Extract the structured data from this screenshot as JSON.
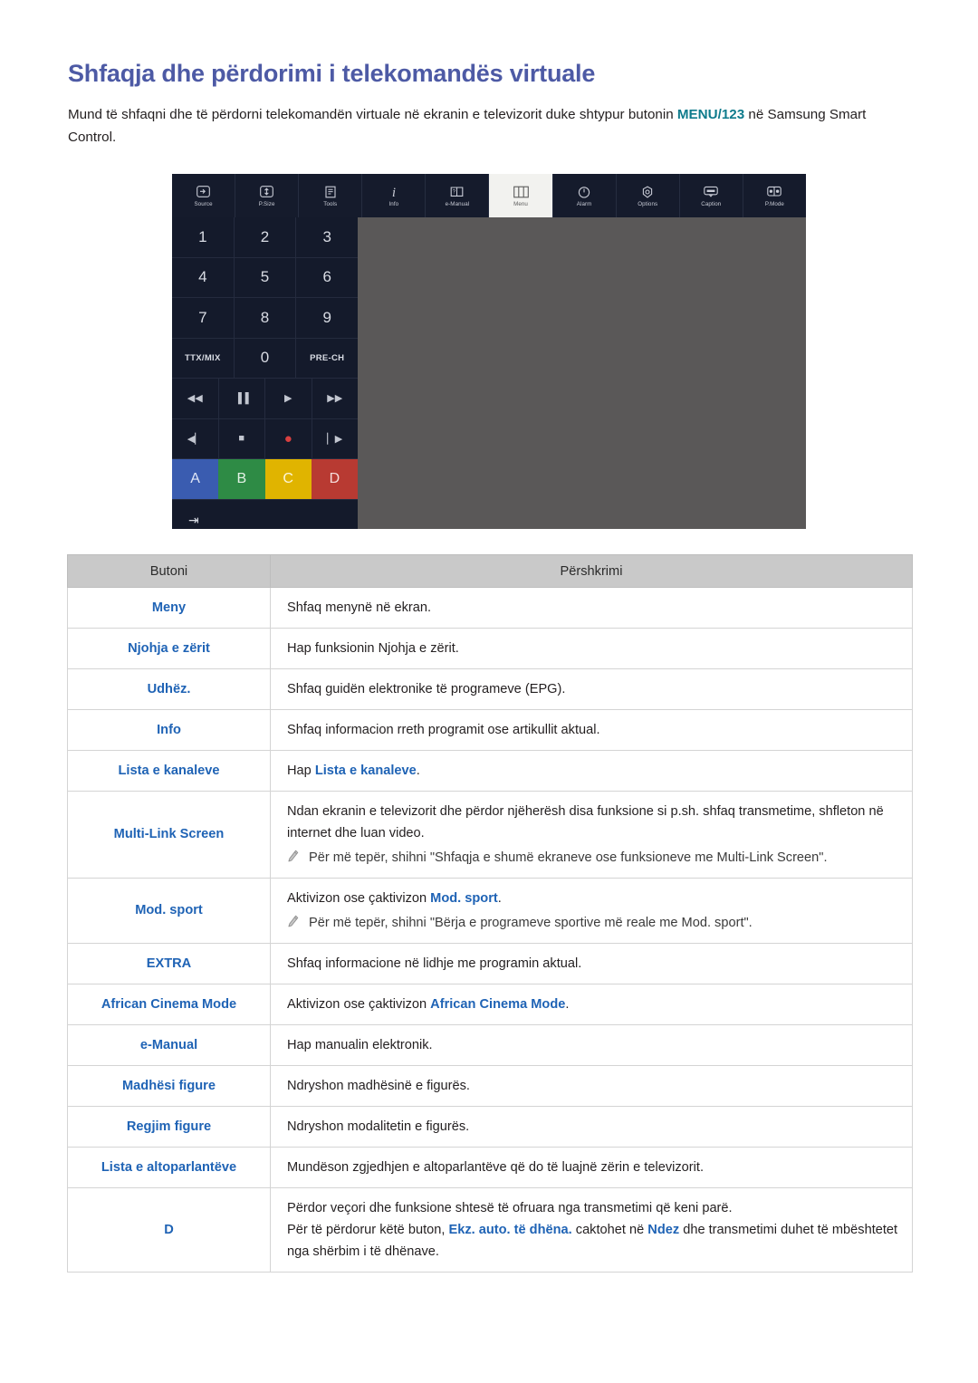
{
  "page": {
    "title": "Shfaqja dhe përdorimi i telekomandës virtuale",
    "intro_part1": "Mund të shfaqni dhe të përdorni telekomandën virtuale në ekranin e televizorit duke shtypur butonin ",
    "intro_keyword": "MENU/123",
    "intro_part2": " në Samsung Smart Control."
  },
  "colors": {
    "heading": "#4d5aa5",
    "link": "#1f63b5",
    "keyword": "#0e7b8c",
    "table_header_bg": "#c9c9c9",
    "panel_dark": "#141a2b",
    "figure_bg": "#5a5858",
    "btn_a": "#3a5cb0",
    "btn_b": "#2e8b45",
    "btn_c": "#e0b400",
    "btn_d": "#b83a32"
  },
  "remote": {
    "toolbar": [
      {
        "label": "Source",
        "icon": "source-icon",
        "selected": false
      },
      {
        "label": "P.Size",
        "icon": "picture-size-icon",
        "selected": false
      },
      {
        "label": "Tools",
        "icon": "tools-icon",
        "selected": false
      },
      {
        "label": "Info",
        "icon": "info-icon",
        "selected": false
      },
      {
        "label": "e-Manual",
        "icon": "e-manual-icon",
        "selected": false
      },
      {
        "label": "Menu",
        "icon": "menu-icon",
        "selected": true
      },
      {
        "label": "Alarm",
        "icon": "alarm-icon",
        "selected": false
      },
      {
        "label": "Options",
        "icon": "options-icon",
        "selected": false
      },
      {
        "label": "Caption",
        "icon": "caption-icon",
        "selected": false
      },
      {
        "label": "P.Mode",
        "icon": "picture-mode-icon",
        "selected": false
      }
    ],
    "keypad": [
      [
        "1",
        "2",
        "3"
      ],
      [
        "4",
        "5",
        "6"
      ],
      [
        "7",
        "8",
        "9"
      ],
      [
        "TTX/MIX",
        "0",
        "PRE-CH"
      ]
    ],
    "media_row1": [
      "rewind-icon",
      "pause-icon",
      "play-icon",
      "fast-forward-icon"
    ],
    "media_row2": [
      "previous-icon",
      "stop-icon",
      "record-icon",
      "next-icon"
    ],
    "media_row1_glyphs": [
      "◀◀",
      "▐▐",
      "▶",
      "▶▶"
    ],
    "media_row2_glyphs": [
      "◀▏",
      "■",
      "●",
      "▏▶"
    ],
    "color_buttons": [
      "A",
      "B",
      "C",
      "D"
    ],
    "bottom_button": "⇥"
  },
  "table": {
    "headers": [
      "Butoni",
      "Përshkrimi"
    ],
    "rows": [
      {
        "button": "Meny",
        "desc": "Shfaq menynë në ekran."
      },
      {
        "button": "Njohja e zërit",
        "desc": "Hap funksionin Njohja e zërit."
      },
      {
        "button": "Udhëz.",
        "desc": "Shfaq guidën elektronike të programeve (EPG)."
      },
      {
        "button": "Info",
        "desc": "Shfaq informacion rreth programit ose artikullit aktual."
      },
      {
        "button": "Lista e kanaleve",
        "desc_pre": "Hap ",
        "desc_link": "Lista e kanaleve",
        "desc_post": "."
      },
      {
        "button": "Multi-Link Screen",
        "desc": "Ndan ekranin e televizorit dhe përdor njëherësh disa funksione si p.sh. shfaq transmetime, shfleton në internet dhe luan video.",
        "note": "Për më tepër, shihni \"Shfaqja e shumë ekraneve ose funksioneve me Multi-Link Screen\"."
      },
      {
        "button": "Mod. sport",
        "desc_pre": "Aktivizon ose çaktivizon ",
        "desc_link": "Mod. sport",
        "desc_post": ".",
        "note": "Për më tepër, shihni \"Bërja e programeve sportive më reale me Mod. sport\"."
      },
      {
        "button": "EXTRA",
        "desc": "Shfaq informacione në lidhje me programin aktual."
      },
      {
        "button": "African Cinema Mode",
        "desc_pre": "Aktivizon ose çaktivizon ",
        "desc_link": "African Cinema Mode",
        "desc_post": "."
      },
      {
        "button": "e-Manual",
        "desc": "Hap manualin elektronik."
      },
      {
        "button": "Madhësi figure",
        "desc": "Ndryshon madhësinë e figurës."
      },
      {
        "button": "Regjim figure",
        "desc": "Ndryshon modalitetin e figurës."
      },
      {
        "button": "Lista e altoparlantëve",
        "desc": "Mundëson zgjedhjen e altoparlantëve që do të luajnë zërin e televizorit."
      },
      {
        "button": "D",
        "desc_line1": "Përdor veçori dhe funksione shtesë të ofruara nga transmetimi që keni parë.",
        "desc_line2_pre": "Për të përdorur këtë buton, ",
        "desc_line2_link1": "Ekz. auto. të dhëna.",
        "desc_line2_mid": " caktohet në ",
        "desc_line2_link2": "Ndez",
        "desc_line2_post": "  dhe transmetimi duhet të mbështetet nga shërbim i të dhënave."
      }
    ]
  }
}
